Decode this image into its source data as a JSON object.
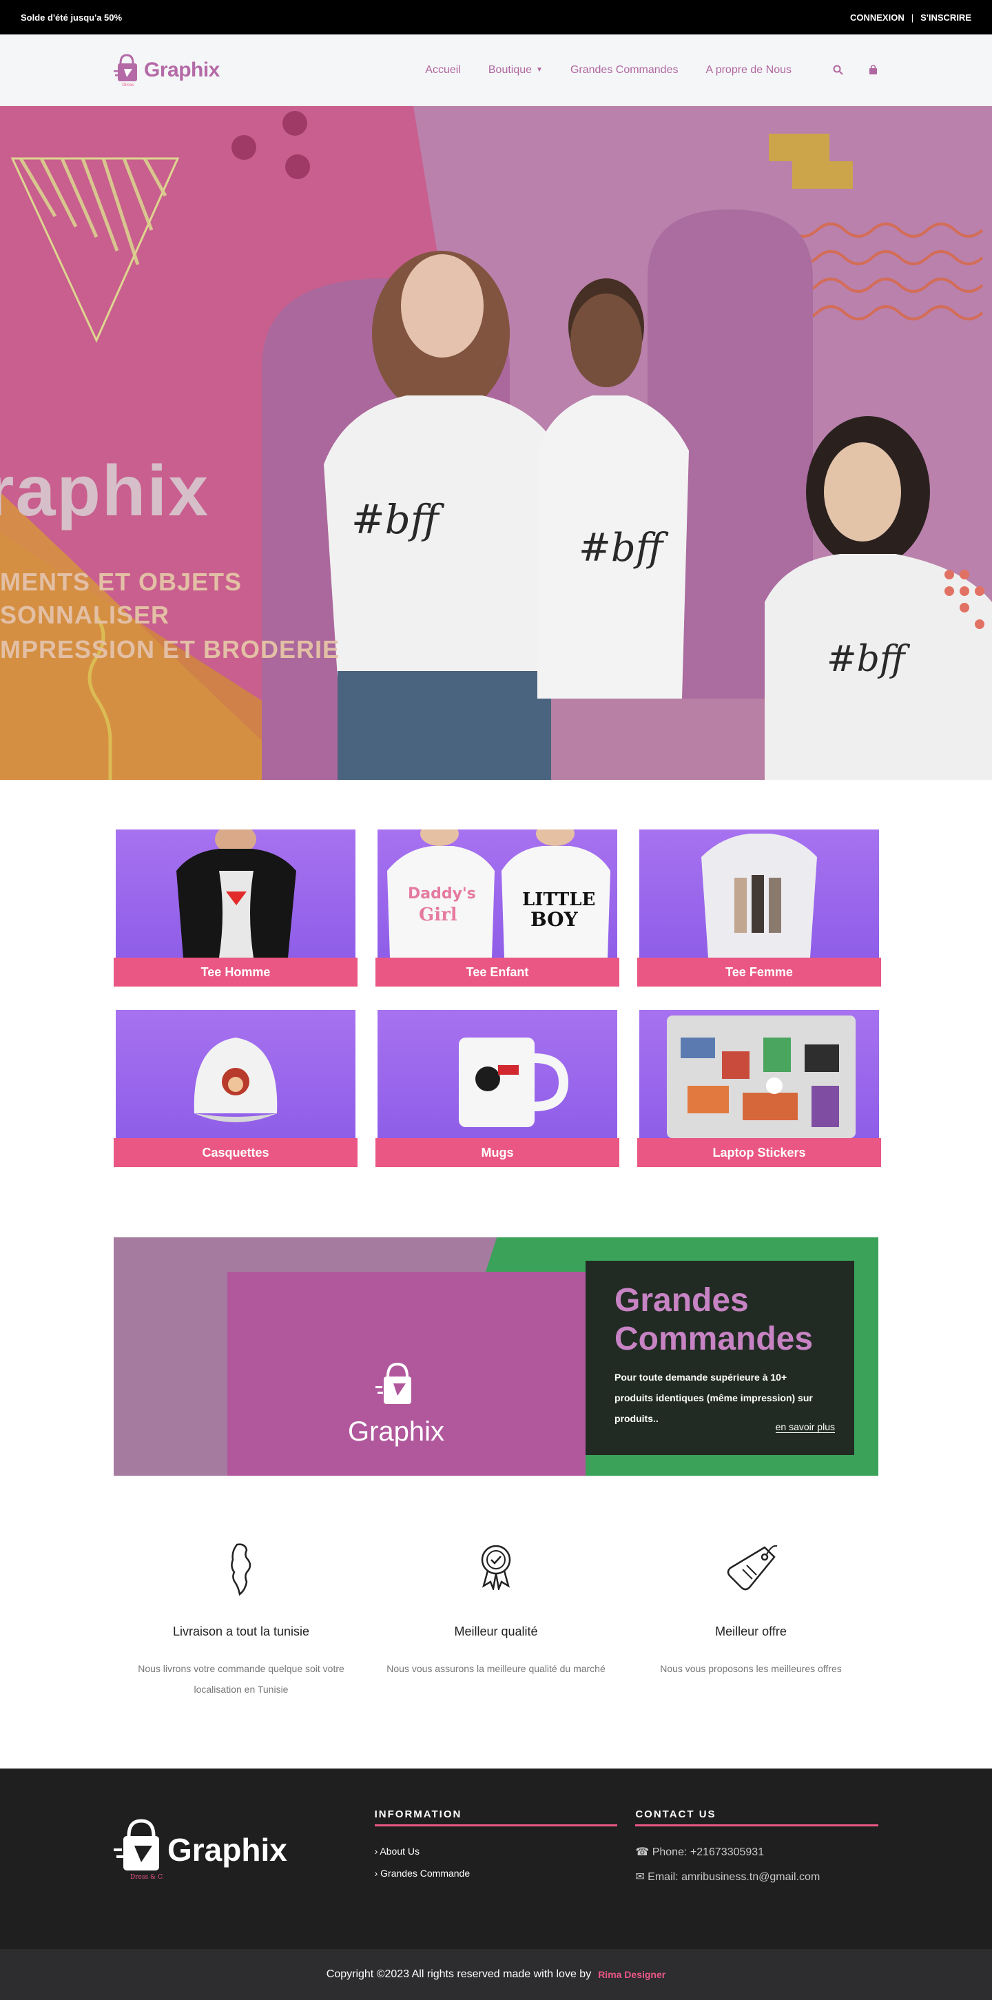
{
  "topbar": {
    "promo": "Solde d'été jusqu'a 50%",
    "login": "CONNEXION",
    "separator": "|",
    "signup": "S'INSCRIRE"
  },
  "header": {
    "brand": "Graphix",
    "tagline": "Dress & Chic",
    "nav": {
      "home": "Accueil",
      "shop": "Boutique",
      "bulk": "Grandes Commandes",
      "about": "A propre de Nous"
    },
    "icons": [
      "search-icon",
      "cart-icon"
    ]
  },
  "hero": {
    "brand": "raphix",
    "line1": "MENTS ET OBJETS",
    "line2": "SONNALISER",
    "line3": "MPRESSION ET BRODERIE",
    "shirt_text": "#bff",
    "slides_count": 2,
    "active_slide": 1,
    "colors": {
      "pink": "#c4507f",
      "mauve": "#b57aa6",
      "orange": "#d38a3a"
    }
  },
  "categories": [
    {
      "label": "Tee Homme",
      "icon": "tshirt-icon"
    },
    {
      "label": "Tee Enfant",
      "icon": "kids-tshirt-icon"
    },
    {
      "label": "Tee Femme",
      "icon": "women-tshirt-icon"
    },
    {
      "label": "Casquettes",
      "icon": "cap-icon"
    },
    {
      "label": "Mugs",
      "icon": "mug-icon"
    },
    {
      "label": "Laptop Stickers",
      "icon": "laptop-icon"
    }
  ],
  "promo": {
    "title": "Grandes Commandes",
    "text": "Pour toute demande supérieure à 10+ produits identiques (même impression) sur produits..",
    "cta": "en savoir plus",
    "box_brand": "Graphix"
  },
  "features": [
    {
      "title": "Livraison a tout la tunisie",
      "text": "Nous livrons votre commande quelque soit votre localisation en Tunisie",
      "icon": "tunisia-map-icon"
    },
    {
      "title": "Meilleur qualité",
      "text": "Nous vous assurons la meilleure qualité du marché",
      "icon": "award-badge-icon"
    },
    {
      "title": "Meilleur offre",
      "text": "Nous vous proposons les meilleures offres",
      "icon": "price-tag-icon"
    }
  ],
  "footer": {
    "brand": "Graphix",
    "tagline": "Dress & Chic",
    "info_title": "INFORMATION",
    "links": [
      "About Us",
      "Grandes Commande"
    ],
    "contact_title": "CONTACT US",
    "phone": "Phone: +21673305931",
    "email": "Email: amribusiness.tn@gmail.com",
    "copyright": "Copyright ©2023 All rights reserved made with love by",
    "author": "Rima Designer"
  },
  "colors": {
    "accent": "#ea5784",
    "brand": "#b46aa6",
    "category_bg": "#9c68ef",
    "footer_bg": "#1f1f20"
  }
}
